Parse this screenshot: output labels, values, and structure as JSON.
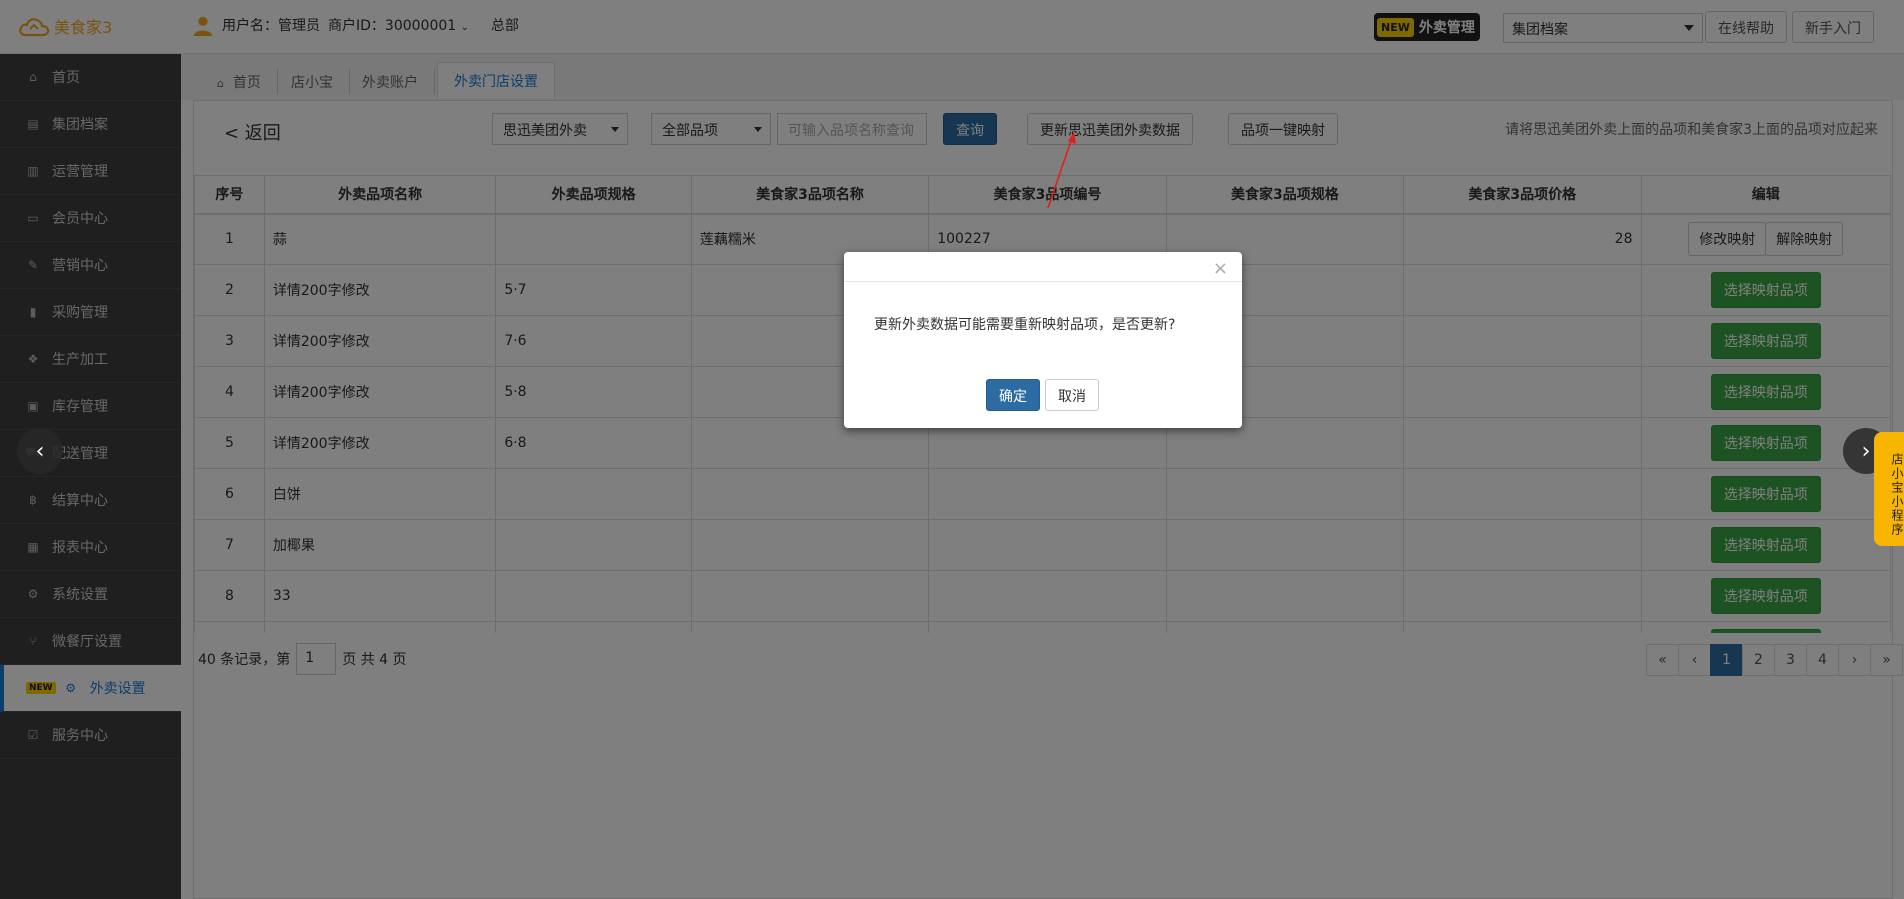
{
  "header": {
    "logo_text": "美食家3",
    "user_label": "用户名：管理员",
    "merchant_label": "商户ID：30000001",
    "branch": "总部",
    "new_tag": "NEW",
    "takeout_btn": "外卖管理",
    "dropdown_value": "集团档案",
    "help_btn": "在线帮助",
    "guide_btn": "新手入门"
  },
  "sidebar": {
    "items": [
      {
        "label": "首页",
        "icon": "home-icon"
      },
      {
        "label": "集团档案",
        "icon": "file-icon"
      },
      {
        "label": "运营管理",
        "icon": "chart-icon"
      },
      {
        "label": "会员中心",
        "icon": "card-icon"
      },
      {
        "label": "营销中心",
        "icon": "edit-icon"
      },
      {
        "label": "采购管理",
        "icon": "book-icon"
      },
      {
        "label": "生产加工",
        "icon": "cubes-icon"
      },
      {
        "label": "库存管理",
        "icon": "box-icon"
      },
      {
        "label": "配送管理",
        "icon": "truck-icon"
      },
      {
        "label": "结算中心",
        "icon": "bitcoin-icon"
      },
      {
        "label": "报表中心",
        "icon": "report-icon"
      },
      {
        "label": "系统设置",
        "icon": "gears-icon"
      },
      {
        "label": "微餐厅设置",
        "icon": "cutlery-icon"
      },
      {
        "label": "外卖设置",
        "icon": "gear-icon",
        "new": "NEW"
      },
      {
        "label": "服务中心",
        "icon": "checkbox-icon"
      }
    ]
  },
  "tabs": [
    {
      "label": "首页"
    },
    {
      "label": "店小宝"
    },
    {
      "label": "外卖账户"
    },
    {
      "label": "外卖门店设置"
    }
  ],
  "toolbar": {
    "back": "< 返回",
    "platform_select": "思迅美团外卖",
    "category_select": "全部品项",
    "search_placeholder": "可输入品项名称查询",
    "query_btn": "查询",
    "update_btn": "更新思迅美团外卖数据",
    "map_btn": "品项一键映射",
    "hint": "请将思迅美团外卖上面的品项和美食家3上面的品项对应起来"
  },
  "table": {
    "headers": [
      "序号",
      "外卖品项名称",
      "外卖品项规格",
      "美食家3品项名称",
      "美食家3品项编号",
      "美食家3品项规格",
      "美食家3品项价格",
      "编辑"
    ],
    "rows": [
      {
        "no": "1",
        "name": "蒜",
        "spec": "",
        "mname": "莲藕糯米",
        "mcode": "100227",
        "mspec": "",
        "mprice": "28"
      },
      {
        "no": "2",
        "name": "详情200字修改",
        "spec": "5·7",
        "mname": "",
        "mcode": "",
        "mspec": "",
        "mprice": ""
      },
      {
        "no": "3",
        "name": "详情200字修改",
        "spec": "7·6",
        "mname": "",
        "mcode": "",
        "mspec": "",
        "mprice": ""
      },
      {
        "no": "4",
        "name": "详情200字修改",
        "spec": "5·8",
        "mname": "",
        "mcode": "",
        "mspec": "",
        "mprice": ""
      },
      {
        "no": "5",
        "name": "详情200字修改",
        "spec": "6·8",
        "mname": "",
        "mcode": "",
        "mspec": "",
        "mprice": ""
      },
      {
        "no": "6",
        "name": "白饼",
        "spec": "",
        "mname": "",
        "mcode": "",
        "mspec": "",
        "mprice": ""
      },
      {
        "no": "7",
        "name": "加椰果",
        "spec": "",
        "mname": "",
        "mcode": "",
        "mspec": "",
        "mprice": ""
      },
      {
        "no": "8",
        "name": "33",
        "spec": "",
        "mname": "",
        "mcode": "",
        "mspec": "",
        "mprice": ""
      },
      {
        "no": "",
        "name": "",
        "spec": "",
        "mname": "",
        "mcode": "",
        "mspec": "",
        "mprice": ""
      }
    ],
    "edit_btn": "修改映射",
    "unmap_btn": "解除映射",
    "select_btn": "选择映射品项"
  },
  "footer": {
    "records_prefix": "40 条记录，第",
    "page_value": "1",
    "records_suffix": "页 共 4 页",
    "pages": [
      "«",
      "‹",
      "1",
      "2",
      "3",
      "4",
      "›",
      "»"
    ],
    "active_page": "1"
  },
  "side_badge": "店小宝小程序",
  "modal": {
    "close": "×",
    "message": "更新外卖数据可能需要重新映射品项，是否更新?",
    "ok": "确定",
    "cancel": "取消"
  },
  "colors": {
    "accent": "#1a7cd6",
    "primary_btn": "#2d6ca2",
    "green_btn": "#3aa645",
    "sidebar_bg": "#3f3f3f",
    "badge_yellow": "#ffd200"
  }
}
